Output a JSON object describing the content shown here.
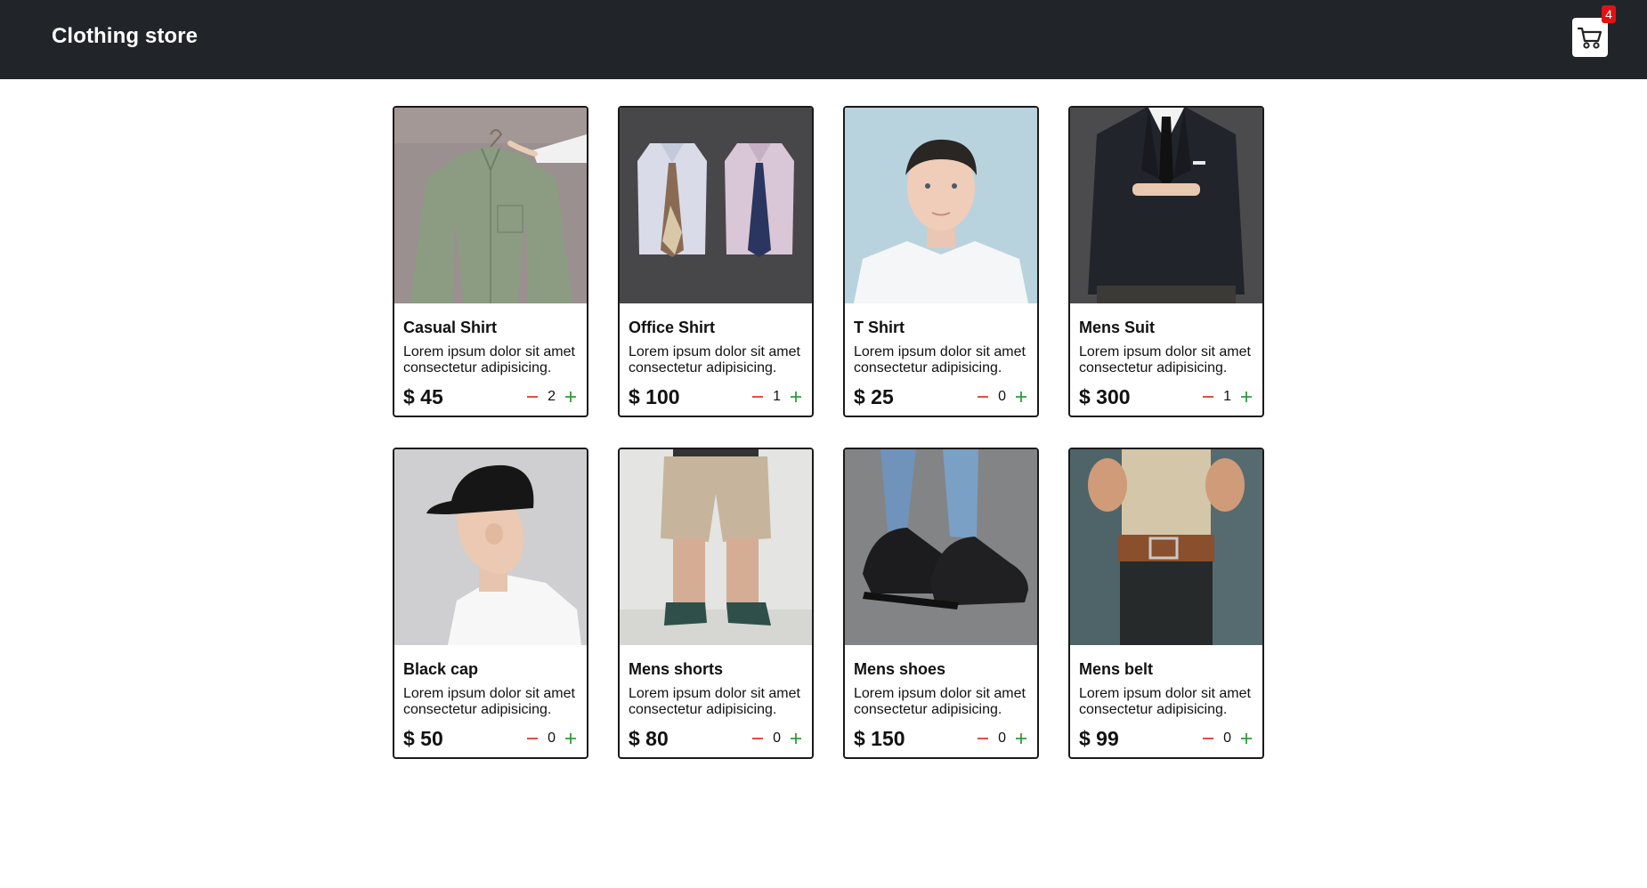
{
  "header": {
    "brand": "Clothing store",
    "cart_count": "4"
  },
  "description": "Lorem ipsum dolor sit amet consectetur adipisicing.",
  "products": [
    {
      "name": "Casual Shirt",
      "price": "$ 45",
      "qty": "2"
    },
    {
      "name": "Office Shirt",
      "price": "$ 100",
      "qty": "1"
    },
    {
      "name": "T Shirt",
      "price": "$ 25",
      "qty": "0"
    },
    {
      "name": "Mens Suit",
      "price": "$ 300",
      "qty": "1"
    },
    {
      "name": "Black cap",
      "price": "$ 50",
      "qty": "0"
    },
    {
      "name": "Mens shorts",
      "price": "$ 80",
      "qty": "0"
    },
    {
      "name": "Mens shoes",
      "price": "$ 150",
      "qty": "0"
    },
    {
      "name": "Mens belt",
      "price": "$ 99",
      "qty": "0"
    }
  ],
  "icons": {
    "cart": "cart-icon",
    "minus": "minus-icon",
    "plus": "plus-icon"
  },
  "colors": {
    "navbar": "#212529",
    "badge": "#e01313",
    "minus": "#e53935",
    "plus": "#2e9c3e"
  }
}
